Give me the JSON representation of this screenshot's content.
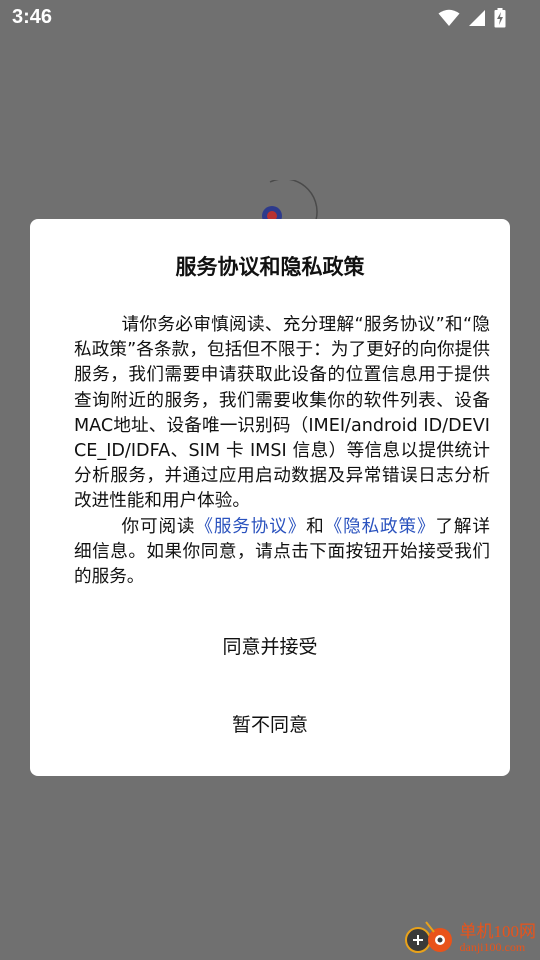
{
  "status_bar": {
    "time": "3:46"
  },
  "dialog": {
    "title": "服务协议和隐私政策",
    "paragraph1": "请你务必审慎阅读、充分理解“服务协议”和“隐私政策”各条款，包括但不限于：为了更好的向你提供服务，我们需要申请获取此设备的位置信息用于提供查询附近的服务，我们需要收集你的软件列表、设备MAC地址、设备唯一识别码（IMEI/android ID/DEVICE_ID/IDFA、SIM 卡 IMSI 信息）等信息以提供统计分析服务，并通过应用启动数据及异常错误日志分析改进性能和用户体验。",
    "paragraph2_prefix": "你可阅读",
    "service_link": "《服务协议》",
    "paragraph2_and": "和",
    "privacy_link": "《隐私政策》",
    "paragraph2_suffix": "了解详细信息。如果你同意，请点击下面按钮开始接受我们的服务。",
    "accept_label": "同意并接受",
    "decline_label": "暂不同意",
    "link_color": "#2a52be"
  },
  "watermark": {
    "name": "单机100网",
    "url": "danji100.com"
  },
  "icons": [
    "wifi-icon",
    "signal-icon",
    "battery-icon",
    "app-logo-icon",
    "watermark-logo"
  ]
}
